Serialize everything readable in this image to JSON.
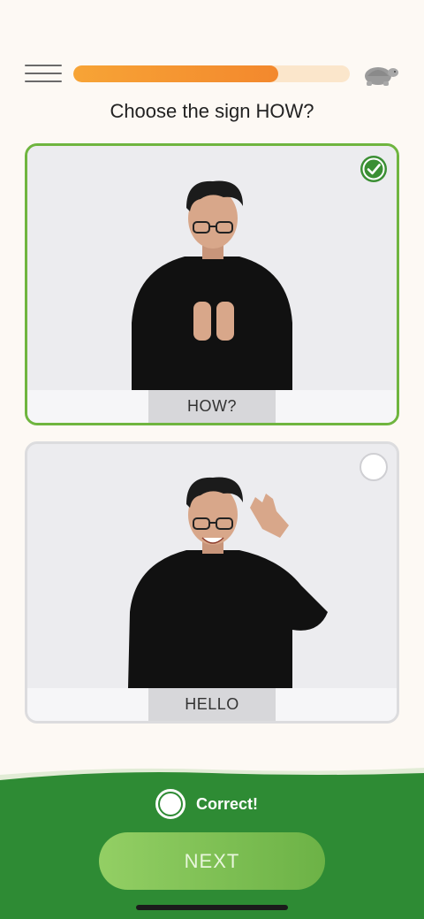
{
  "progress": {
    "fraction": 0.74
  },
  "question": "Choose the sign HOW?",
  "answers": [
    {
      "label": "HOW?",
      "state": "selected-correct"
    },
    {
      "label": "HELLO",
      "state": "unselected"
    }
  ],
  "feedback": {
    "status": "Correct!",
    "next_label": "NEXT"
  },
  "colors": {
    "background": "#fdf9f4",
    "progress": "#f3882d",
    "correct_border": "#6fb53f",
    "feedback_panel": "#2e8b34",
    "next_button": "#7ec155"
  },
  "icons": {
    "menu": "menu-icon",
    "speed": "turtle-icon",
    "check": "check-circle-icon",
    "radio": "radio-empty-icon"
  }
}
